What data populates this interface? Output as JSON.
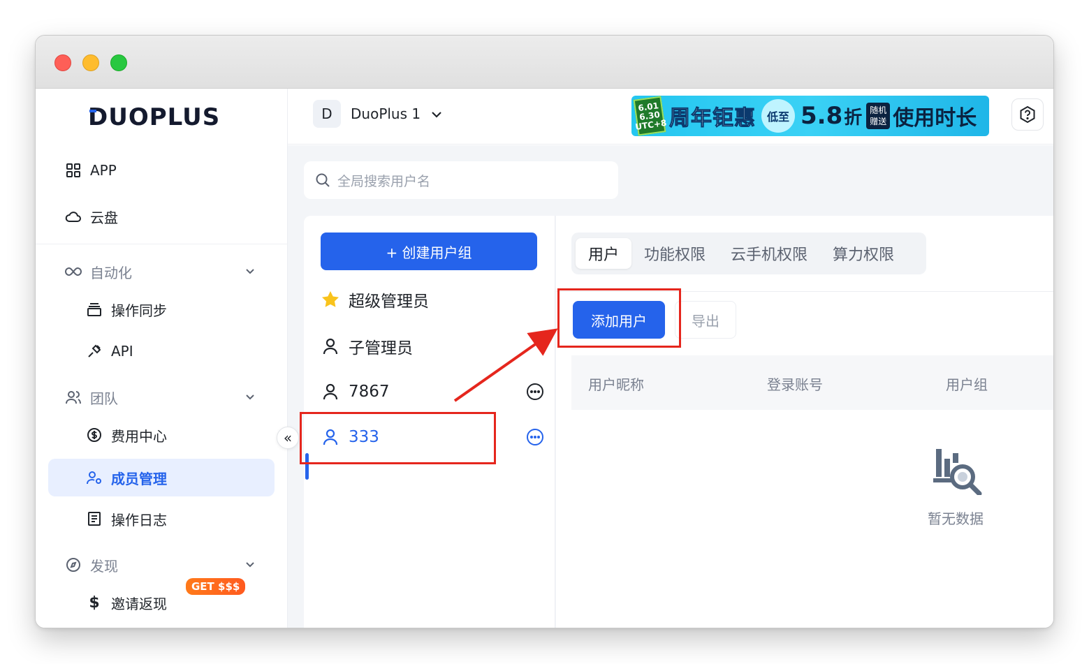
{
  "brand": {
    "logo_text": "DUOPLUS"
  },
  "sidebar": {
    "items": [
      {
        "label": "APP",
        "icon": "grid-icon"
      },
      {
        "label": "云盘",
        "icon": "cloud-icon"
      }
    ],
    "sections": [
      {
        "label": "自动化",
        "icon": "infinity-icon",
        "children": [
          {
            "label": "操作同步",
            "icon": "layers-icon"
          },
          {
            "label": "API",
            "icon": "plug-icon"
          }
        ]
      },
      {
        "label": "团队",
        "icon": "team-icon",
        "children": [
          {
            "label": "费用中心",
            "icon": "dollar-circle-icon"
          },
          {
            "label": "成员管理",
            "icon": "user-gear-icon"
          },
          {
            "label": "操作日志",
            "icon": "log-icon"
          }
        ]
      },
      {
        "label": "发现",
        "icon": "compass-icon",
        "children": [
          {
            "label": "邀请返现",
            "icon": "dollar-icon",
            "badge": "GET $$$"
          }
        ]
      }
    ],
    "active": "成员管理"
  },
  "topbar": {
    "workspace_initial": "D",
    "workspace_name": "DuoPlus 1",
    "banner": {
      "date": "6.01 6.30 UTC+8",
      "headline": "周年钜惠",
      "tag": "低至",
      "discount": "5.8",
      "discount_unit": "折",
      "gift": "随机赠送",
      "tail": "使用时长"
    }
  },
  "search": {
    "placeholder": "全局搜索用户名"
  },
  "groups": {
    "create_label": "+ 创建用户组",
    "items": [
      {
        "label": "超级管理员",
        "icon": "star-icon"
      },
      {
        "label": "子管理员",
        "icon": "user-icon"
      },
      {
        "label": "7867",
        "icon": "user-icon",
        "more": true
      },
      {
        "label": "333",
        "icon": "user-icon",
        "more": true,
        "selected": true
      }
    ]
  },
  "main": {
    "tabs": [
      "用户",
      "功能权限",
      "云手机权限",
      "算力权限"
    ],
    "active_tab": "用户",
    "add_user_label": "添加用户",
    "export_label": "导出",
    "columns": [
      "用户昵称",
      "登录账号",
      "用户组"
    ],
    "empty_text": "暂无数据"
  },
  "colors": {
    "accent": "#2563eb",
    "highlight": "#e5261d",
    "active_bg": "#e8efff"
  }
}
